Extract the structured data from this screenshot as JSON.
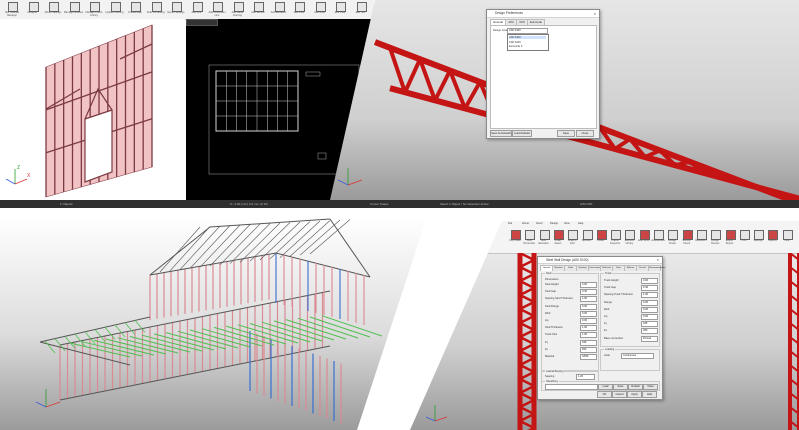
{
  "panel1": {
    "ribbon": {
      "buttons": [
        "Site Cleanup Manager",
        "Designer",
        "Model Settings",
        "Manage Libraries",
        "Manage Frame Library",
        "Update Framing",
        "Prefabricate",
        "Tools & Framing",
        "Expert Settings",
        "Add Line",
        "Add Dimension Line",
        "Add Gable Framing",
        "Add Section",
        "Add Elevation",
        "Add View",
        "Add Note",
        "Edit View",
        "Edit Text"
      ],
      "group_labels": [
        "General",
        "Drawing Tools"
      ]
    },
    "wall_viewport": {
      "bg": "#ffffff",
      "frame_color": "#e8a5a8"
    },
    "drawing_viewport": {
      "bg": "#000000"
    },
    "status": [
      "1 Objects",
      "Z: -2.00 (mm) 0.0 mm (Z 16)",
      "Cursor Snaps"
    ]
  },
  "panel2": {
    "truss_color": "#e01e1e",
    "dialog": {
      "title": "Design Preferences",
      "tabs": [
        "General",
        "AISI",
        "CFS",
        "Eurocode"
      ],
      "design_code_label": "Design Code:",
      "design_code_value": "AISI S100",
      "dropdown_options": [
        "AISI S100",
        "AISI S240",
        "Eurocode 3"
      ],
      "buttons": {
        "save_defaults": "Save As Defaults",
        "load_defaults": "Load Defaults",
        "save": "Save",
        "close": "Close"
      }
    },
    "status": [
      "Open Model",
      "Select 1 Object / No Selection Active",
      "AISI OFF"
    ]
  },
  "panel3": {
    "frame_color": "#e8a5a8"
  },
  "panel4": {
    "tabs": [
      "File",
      "Home",
      "Insert",
      "Design",
      "View",
      "Help"
    ],
    "ribbon_buttons": [
      "Clip Plane",
      "Auto Dimension",
      "Auto Elevation",
      "Smart Select",
      "Snap to Grid",
      "Sections",
      "Finder",
      "Frame Inspector",
      "Element Library",
      "Auto Dims",
      "Accessories",
      "Design Check",
      "Section Check",
      "Deflection",
      "Design Review",
      "Export Report",
      "Print",
      "Settings",
      "Options",
      "Help"
    ],
    "truss_color": "#e01e1e",
    "dialog": {
      "title": "Steel Wall Design (AISI S100)",
      "tabs": [
        "General",
        "Members",
        "Studs",
        "Openings",
        "Connections",
        "Deflection",
        "Ratio",
        "Stiffener",
        "Results",
        "Recommendations"
      ],
      "left_group": "Stud",
      "left_subgroup": "Dimensions",
      "left_fields": [
        {
          "label": "Stud Height",
          "value": "3.00"
        },
        {
          "label": "Stud Gap",
          "value": "0.40"
        },
        {
          "label": "Spacing Stud Thickness",
          "value": "1.00"
        },
        {
          "label": "Stud Flange",
          "value": "0.00"
        },
        {
          "label": "Web",
          "value": "0.00"
        },
        {
          "label": "Lip",
          "value": "0.00"
        },
        {
          "label": "Stud Thickness",
          "value": "1.00"
        },
        {
          "label": "Track Size",
          "value": "1.00"
        },
        {
          "label": "Fy",
          "value": "345"
        },
        {
          "label": "Fu",
          "value": "450"
        },
        {
          "label": "Material",
          "value": "G550"
        }
      ],
      "left_group2": "Lateral Bracing",
      "bracing_label": "Spacing",
      "bracing_value": "1.20",
      "right_group": "Track",
      "right_fields": [
        {
          "label": "Track Height",
          "value": "3.00"
        },
        {
          "label": "Track Gap",
          "value": "0.40"
        },
        {
          "label": "Spacing Track Thickness",
          "value": "1.00"
        },
        {
          "label": "Flange",
          "value": "0.00"
        },
        {
          "label": "Web",
          "value": "0.00"
        },
        {
          "label": "Lip",
          "value": "0.00"
        },
        {
          "label": "Fy",
          "value": "345"
        },
        {
          "label": "Fu",
          "value": "450"
        },
        {
          "label": "Base connection",
          "value": "Pinned"
        }
      ],
      "right_group2": "Loading",
      "load_label": "Axial",
      "load_value": "Continuous",
      "footer_label": "Sheathing",
      "footer_value": "",
      "footer_btns": [
        "Load",
        "Save",
        "Default",
        "Clear"
      ],
      "bottom_btns": [
        "OK",
        "Cancel",
        "Apply",
        "Help"
      ]
    }
  }
}
